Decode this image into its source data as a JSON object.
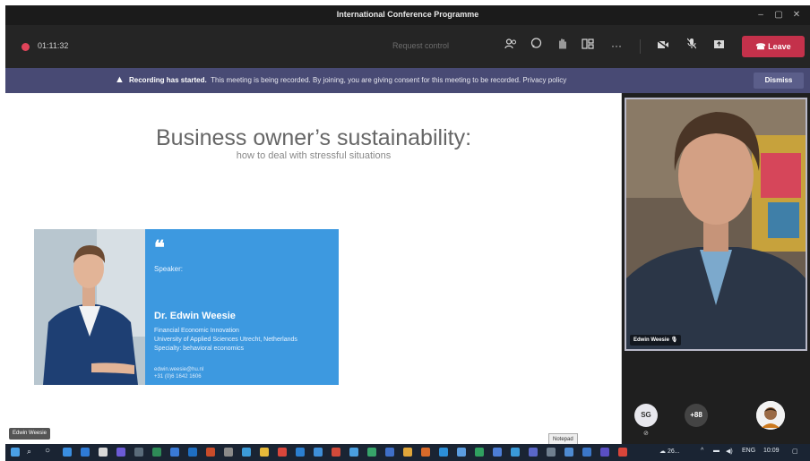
{
  "window": {
    "title": "International Conference Programme",
    "controls": [
      "–",
      "▢",
      "✕"
    ]
  },
  "toolbar": {
    "timer": "01:11:32",
    "request_control": "Request control",
    "leave_label": "Leave",
    "icons": [
      "participants-icon",
      "chat-icon",
      "raise-hand-icon",
      "rooms-icon",
      "more-icon",
      "camera-icon",
      "mic-icon",
      "share-icon"
    ]
  },
  "banner": {
    "bold": "Recording has started.",
    "message": "This meeting is being recorded. By joining, you are giving consent for this meeting to be recorded. Privacy policy",
    "dismiss_label": "Dismiss"
  },
  "slide": {
    "title": "Business owner’s sustainability:",
    "subtitle": "how to deal with stressful situations",
    "card": {
      "quote_mark": "❝",
      "label": "Speaker:",
      "name": "Dr. Edwin Weesie",
      "line1": "Financial Economic Innovation",
      "line2": "University of Applied Sciences Utrecht, Netherlands",
      "line3": "Specialty: behavioral economics",
      "contact1": "edwin.weesie@hu.nl",
      "contact2": "+31 (0)6 1642 1606"
    },
    "presenter_tag": "Edwin Weesie"
  },
  "video": {
    "participant_name": "Edwin Weesie"
  },
  "participants": {
    "initials": "SG",
    "more": "+88"
  },
  "taskbar": {
    "tooltip": "Notepad",
    "tray_text": "26...",
    "lang": "ENG",
    "time": "10:09"
  },
  "colors": {
    "leave": "#c4314b",
    "banner": "#484a74",
    "card": "#3d99e0"
  }
}
